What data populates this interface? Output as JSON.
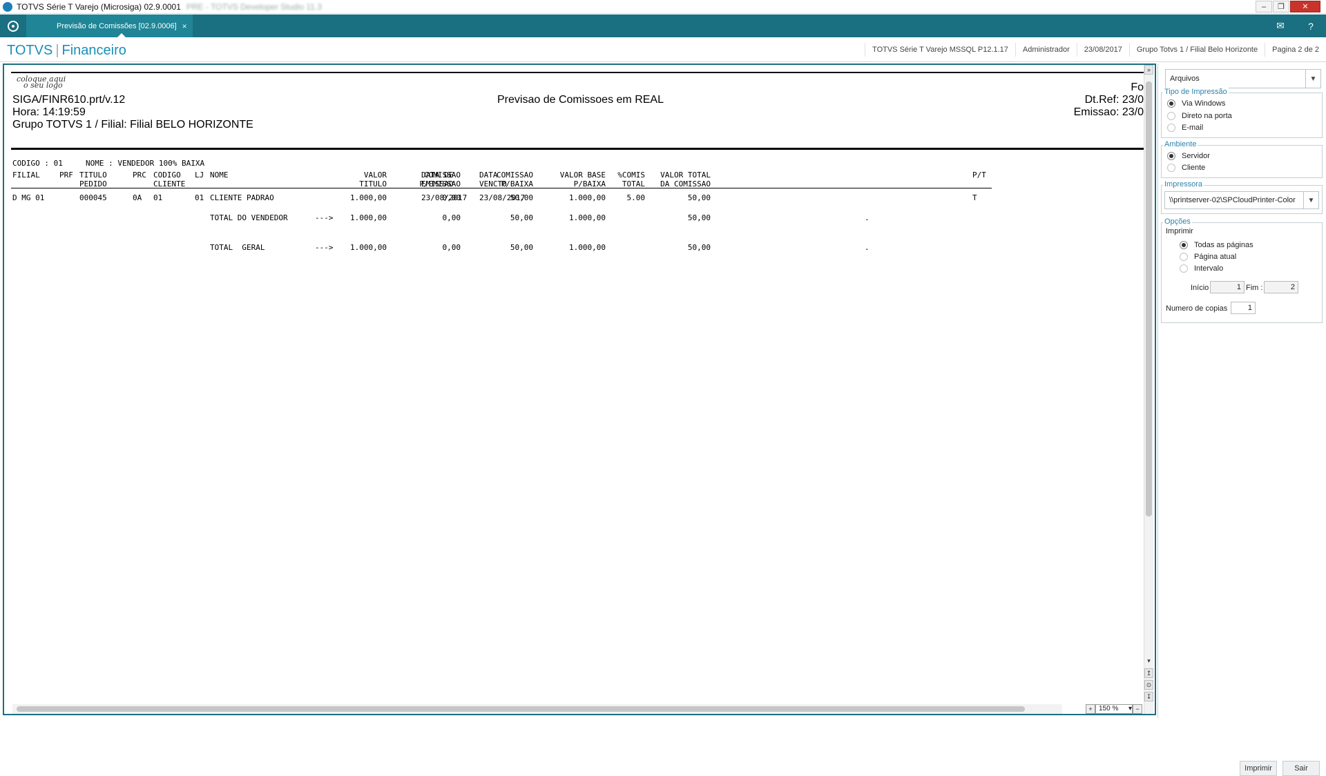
{
  "window": {
    "title": "TOTVS Série T Varejo (Microsiga) 02.9.0001",
    "title_blurred": "PRE - TOTVS Developer Studio 11.3"
  },
  "tabbar": {
    "tab_label": "Previsão de Comissões [02.9.0006]",
    "tab_close": "×",
    "mail_icon": "mail-icon",
    "help_icon": "help-icon"
  },
  "header": {
    "brand": "TOTVS",
    "module": "Financeiro",
    "environment": "TOTVS Série T Varejo MSSQL P12.1.17",
    "user": "Administrador",
    "date": "23/08/2017",
    "branch": "Grupo Totvs 1 / Filial Belo Horizonte",
    "page": "Pagina 2 de 2"
  },
  "report": {
    "logo_line1": "coloque aqui",
    "logo_line2": "o seu logo",
    "program": "SIGA/FINR610.prt/v.12",
    "time": "Hora: 14:19:59",
    "group": "Grupo TOTVS 1 / Filial: Filial BELO HORIZONTE",
    "title": "Previsao de Comissoes em REAL",
    "folha": "Fo",
    "dt_ref": "Dt.Ref: 23/0",
    "emissao": "Emissao: 23/0",
    "codigo_line": "CODIGO : 01     NOME : VENDEDOR 100% BAIXA",
    "columns": {
      "filial": "FILIAL",
      "prf": "PRF",
      "titulo_1": "TITULO",
      "titulo_2": "PEDIDO",
      "prc": "PRC",
      "codigo_1": "CODIGO",
      "codigo_2": "CLIENTE",
      "lj": "LJ",
      "nome": "NOME",
      "dt_emissao_1": "DATA DE",
      "dt_emissao_2": "EMISSAO",
      "dt_vencto_1": "DATA",
      "dt_vencto_2": "VENCTO",
      "valor_1": "VALOR",
      "valor_2": "TITULO",
      "com_emis_1": "COMISSAO",
      "com_emis_2": "P/EMISSAO",
      "com_baixa_1": "COMISSAO",
      "com_baixa_2": "P/BAIXA",
      "vbase_1": "VALOR BASE",
      "vbase_2": "P/BAIXA",
      "pcomis_1": "%COMIS",
      "pcomis_2": "TOTAL",
      "vtotal_1": "VALOR TOTAL",
      "vtotal_2": "DA COMISSAO",
      "pt": "P/T"
    },
    "row": {
      "filial": "D MG 01",
      "titulo": "000045",
      "prc": "0A",
      "codigo": "01",
      "lj": "01",
      "nome": "CLIENTE PADRAO",
      "emissao": "23/08/2017",
      "vencto": "23/08/2017",
      "valor": "1.000,00",
      "com_emis": "0,00",
      "com_baixa": "50,00",
      "vbase": "1.000,00",
      "pcomis": "5.00",
      "vtotal": "50,00",
      "pt": "T"
    },
    "total_vendedor": {
      "label": "TOTAL DO VENDEDOR",
      "arrow": "--->",
      "valor": "1.000,00",
      "com_emis": "0,00",
      "com_baixa": "50,00",
      "vbase": "1.000,00",
      "pcomis": ".",
      "vtotal": "50,00"
    },
    "total_geral": {
      "label": "TOTAL  GERAL",
      "arrow": "--->",
      "valor": "1.000,00",
      "com_emis": "0,00",
      "com_baixa": "50,00",
      "vbase": "1.000,00",
      "pcomis": ".",
      "vtotal": "50,00"
    }
  },
  "viewer": {
    "zoom": "150 %"
  },
  "side": {
    "arquivos": "Arquivos",
    "tipo_title": "Tipo de Impressão",
    "tipo_options": [
      "Via Windows",
      "Direto na porta",
      "E-mail"
    ],
    "ambiente_title": "Ambiente",
    "ambiente_options": [
      "Servidor",
      "Cliente"
    ],
    "impressora_title": "Impressora",
    "impressora_value": "\\\\printserver-02\\SPCloudPrinter-Color",
    "opcoes_title": "Opções",
    "imprimir_label": "Imprimir",
    "imprimir_options": [
      "Todas as páginas",
      "Página atual",
      "Intervalo"
    ],
    "inicio_label": "Início :",
    "inicio_value": "1",
    "fim_label": "Fim :",
    "fim_value": "2",
    "copias_label": "Numero de copias",
    "copias_value": "1",
    "btn_imprimir": "Imprimir",
    "btn_sair": "Sair"
  }
}
